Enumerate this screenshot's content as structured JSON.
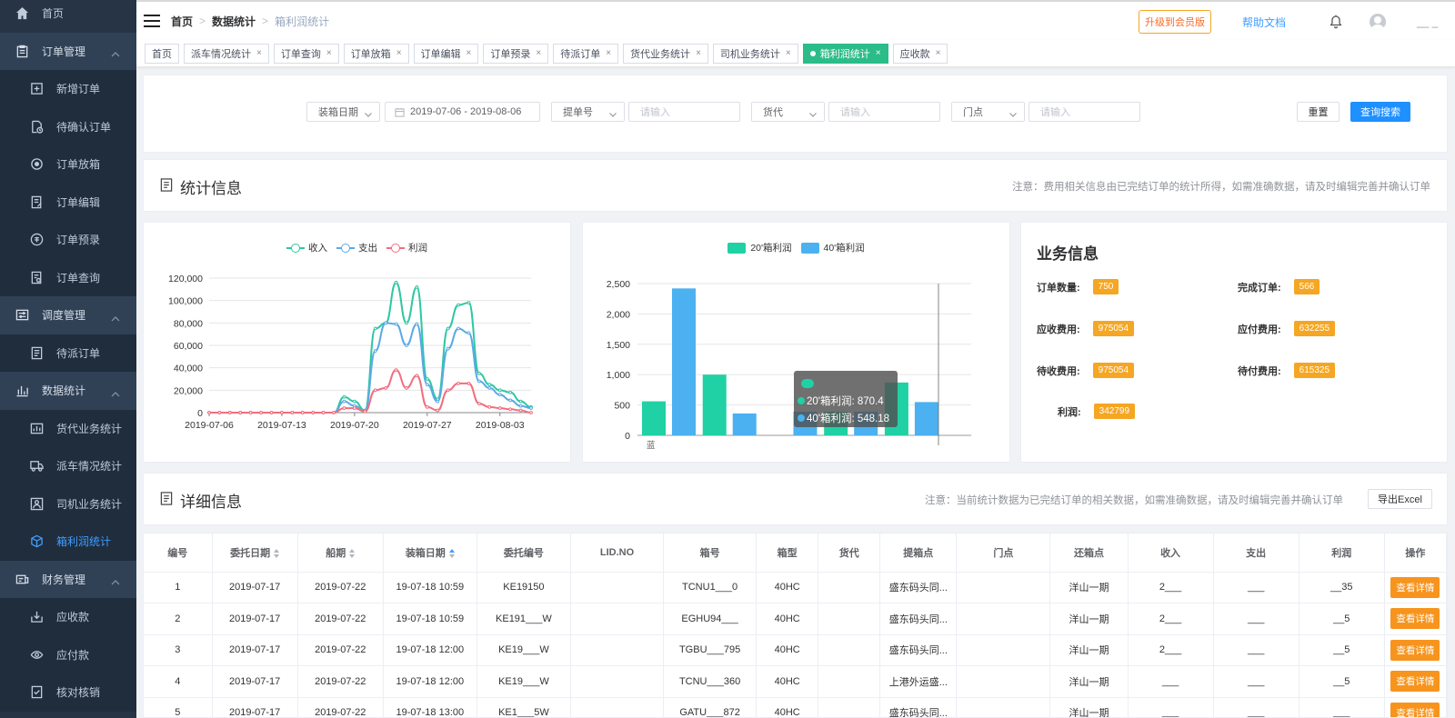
{
  "sidebar": {
    "items": [
      {
        "label": "首页",
        "type": "top",
        "icon": "home-icon"
      },
      {
        "label": "订单管理",
        "type": "group",
        "icon": "clipboard-icon"
      },
      {
        "label": "新增订单",
        "type": "sub",
        "icon": "add-square-icon"
      },
      {
        "label": "待确认订单",
        "type": "sub",
        "icon": "doc-clock-icon"
      },
      {
        "label": "订单放箱",
        "type": "sub",
        "icon": "gear-icon"
      },
      {
        "label": "订单编辑",
        "type": "sub",
        "icon": "doc-edit-icon"
      },
      {
        "label": "订单预录",
        "type": "sub",
        "icon": "circle-doc-icon"
      },
      {
        "label": "订单查询",
        "type": "sub",
        "icon": "doc-search-icon"
      },
      {
        "label": "调度管理",
        "type": "group",
        "icon": "dispatch-icon"
      },
      {
        "label": "待派订单",
        "type": "sub",
        "icon": "doc-icon"
      },
      {
        "label": "数据统计",
        "type": "group",
        "icon": "bar-chart-icon"
      },
      {
        "label": "货代业务统计",
        "type": "sub",
        "icon": "stats-icon"
      },
      {
        "label": "派车情况统计",
        "type": "sub",
        "icon": "truck-icon"
      },
      {
        "label": "司机业务统计",
        "type": "sub",
        "icon": "driver-icon"
      },
      {
        "label": "箱利润统计",
        "type": "sub",
        "icon": "box-icon",
        "active": true
      },
      {
        "label": "财务管理",
        "type": "group",
        "icon": "finance-icon"
      },
      {
        "label": "应收款",
        "type": "sub",
        "icon": "receive-icon"
      },
      {
        "label": "应付款",
        "type": "sub",
        "icon": "pay-icon"
      },
      {
        "label": "核对核销",
        "type": "sub",
        "icon": "check-icon"
      }
    ]
  },
  "header": {
    "breadcrumb": [
      "首页",
      "数据统计",
      "箱利润统计"
    ],
    "upgrade": "升级到会员版",
    "help": "帮助文档",
    "user": "__ _"
  },
  "tags": [
    {
      "label": "首页"
    },
    {
      "label": "派车情况统计"
    },
    {
      "label": "订单查询"
    },
    {
      "label": "订单放箱"
    },
    {
      "label": "订单编辑"
    },
    {
      "label": "订单预录"
    },
    {
      "label": "待派订单"
    },
    {
      "label": "货代业务统计"
    },
    {
      "label": "司机业务统计"
    },
    {
      "label": "箱利润统计",
      "active": true
    },
    {
      "label": "应收款"
    }
  ],
  "filter": {
    "date_type": "装箱日期",
    "date_range": "2019-07-06  -  2019-08-06",
    "field1": "提单号",
    "field1_placeholder": "请输入",
    "field2": "货代",
    "field2_placeholder": "请输入",
    "field3": "门点",
    "field3_placeholder": "请输入",
    "reset": "重置",
    "search": "查询搜索"
  },
  "stats": {
    "title": "统计信息",
    "note": "注意：费用相关信息由已完结订单的统计所得，如需准确数据，请及时编辑完善并确认订单"
  },
  "business": {
    "title": "业务信息",
    "items": [
      {
        "label": "订单数量:",
        "value": "750"
      },
      {
        "label": "完成订单:",
        "value": "566"
      },
      {
        "label": "应收费用:",
        "value": "975054"
      },
      {
        "label": "应付费用:",
        "value": "632255"
      },
      {
        "label": "待收费用:",
        "value": "975054"
      },
      {
        "label": "待付费用:",
        "value": "615325"
      },
      {
        "label": "利润:",
        "value": "342799"
      }
    ]
  },
  "tooltip": {
    "title": "",
    "line1": "20'箱利润: 870.4",
    "line2": "40'箱利润: 548.18"
  },
  "detail": {
    "title": "详细信息",
    "note": "注意：当前统计数据为已完结订单的相关数据，如需准确数据，请及时编辑完善并确认订单",
    "export": "导出Excel",
    "columns": [
      "编号",
      "委托日期",
      "船期",
      "装箱日期",
      "委托编号",
      "LID.NO",
      "箱号",
      "箱型",
      "货代",
      "提箱点",
      "门点",
      "还箱点",
      "收入",
      "支出",
      "利润",
      "操作"
    ],
    "rows": [
      [
        "1",
        "2019-07-17",
        "2019-07-22",
        "19-07-18 10:59",
        "KE19150",
        "",
        "TCNU1___0",
        "40HC",
        "",
        "盛东码头同...",
        "",
        "洋山一期",
        "2___",
        "___",
        "__35",
        "查看详情"
      ],
      [
        "2",
        "2019-07-17",
        "2019-07-22",
        "19-07-18 10:59",
        "KE191___W",
        "",
        "EGHU94___",
        "40HC",
        "",
        "盛东码头同...",
        "",
        "洋山一期",
        "2___",
        "___",
        "__5",
        "查看详情"
      ],
      [
        "3",
        "2019-07-17",
        "2019-07-22",
        "19-07-18 12:00",
        "KE19___W",
        "",
        "TGBU___795",
        "40HC",
        "",
        "盛东码头同...",
        "",
        "洋山一期",
        "2___",
        "___",
        "__5",
        "查看详情"
      ],
      [
        "4",
        "2019-07-17",
        "2019-07-22",
        "19-07-18 12:00",
        "KE19___W",
        "",
        "TCNU___360",
        "40HC",
        "",
        "上港外运盛...",
        "",
        "洋山一期",
        "___",
        "___",
        "__5",
        "查看详情"
      ],
      [
        "5",
        "2019-07-17",
        "2019-07-22",
        "19-07-18 13:00",
        "KE1___5W",
        "",
        "GATU___872",
        "40HC",
        "",
        "盛东码头同...",
        "",
        "洋山一期",
        "___",
        "___",
        "___",
        "查看详情"
      ]
    ]
  },
  "chart_data": [
    {
      "type": "line",
      "legend": [
        "收入",
        "支出",
        "利润"
      ],
      "colors": [
        "#2ec7a3",
        "#5aa9e6",
        "#f26d7d"
      ],
      "x_ticks": [
        "2019-07-06",
        "2019-07-13",
        "2019-07-20",
        "2019-07-27",
        "2019-08-03"
      ],
      "ylim": [
        0,
        120000
      ],
      "y_ticks": [
        "0",
        "20,000",
        "40,000",
        "60,000",
        "80,000",
        "100,000",
        "120,000"
      ],
      "x": [
        "2019-07-06",
        "2019-07-07",
        "2019-07-08",
        "2019-07-09",
        "2019-07-10",
        "2019-07-11",
        "2019-07-12",
        "2019-07-13",
        "2019-07-14",
        "2019-07-15",
        "2019-07-16",
        "2019-07-17",
        "2019-07-18",
        "2019-07-19",
        "2019-07-20",
        "2019-07-21",
        "2019-07-22",
        "2019-07-23",
        "2019-07-24",
        "2019-07-25",
        "2019-07-26",
        "2019-07-27",
        "2019-07-28",
        "2019-07-29",
        "2019-07-30",
        "2019-07-31",
        "2019-08-01",
        "2019-08-02",
        "2019-08-03",
        "2019-08-04",
        "2019-08-05",
        "2019-08-06"
      ],
      "series": [
        {
          "name": "收入",
          "values": [
            0,
            0,
            0,
            0,
            0,
            0,
            0,
            0,
            0,
            0,
            0,
            0,
            0,
            14000,
            10000,
            2000,
            75000,
            80000,
            116000,
            80000,
            112000,
            30000,
            12000,
            75000,
            96000,
            98000,
            35000,
            25000,
            20000,
            18000,
            10000,
            5000
          ]
        },
        {
          "name": "支出",
          "values": [
            0,
            0,
            0,
            0,
            0,
            0,
            0,
            0,
            0,
            0,
            0,
            0,
            0,
            10000,
            6000,
            1000,
            55000,
            80000,
            79000,
            60000,
            79000,
            25000,
            10000,
            57000,
            75000,
            71000,
            28000,
            22000,
            16000,
            11000,
            6000,
            4000
          ]
        },
        {
          "name": "利润",
          "values": [
            0,
            0,
            0,
            0,
            0,
            0,
            0,
            0,
            0,
            0,
            0,
            0,
            0,
            4000,
            4000,
            1000,
            20000,
            22000,
            38000,
            22000,
            33000,
            5000,
            2000,
            20000,
            26000,
            26000,
            8000,
            5000,
            4000,
            3000,
            2000,
            0
          ]
        }
      ]
    },
    {
      "type": "bar",
      "legend": [
        "20'箱利润",
        "40'箱利润"
      ],
      "colors": [
        "#1fd1a4",
        "#4bb1f0"
      ],
      "ylim": [
        0,
        2500
      ],
      "y_ticks": [
        "0",
        "500",
        "1,000",
        "1,500",
        "2,000",
        "2,500"
      ],
      "categories": [
        "",
        "",
        "",
        "",
        "",
        ""
      ],
      "first_label": "蓝",
      "series": [
        {
          "name": "20'箱利润",
          "values": [
            560,
            1000,
            0,
            390,
            870.4,
            0
          ]
        },
        {
          "name": "40'箱利润",
          "values": [
            2420,
            360,
            390,
            390,
            548.18,
            0
          ]
        }
      ]
    }
  ]
}
